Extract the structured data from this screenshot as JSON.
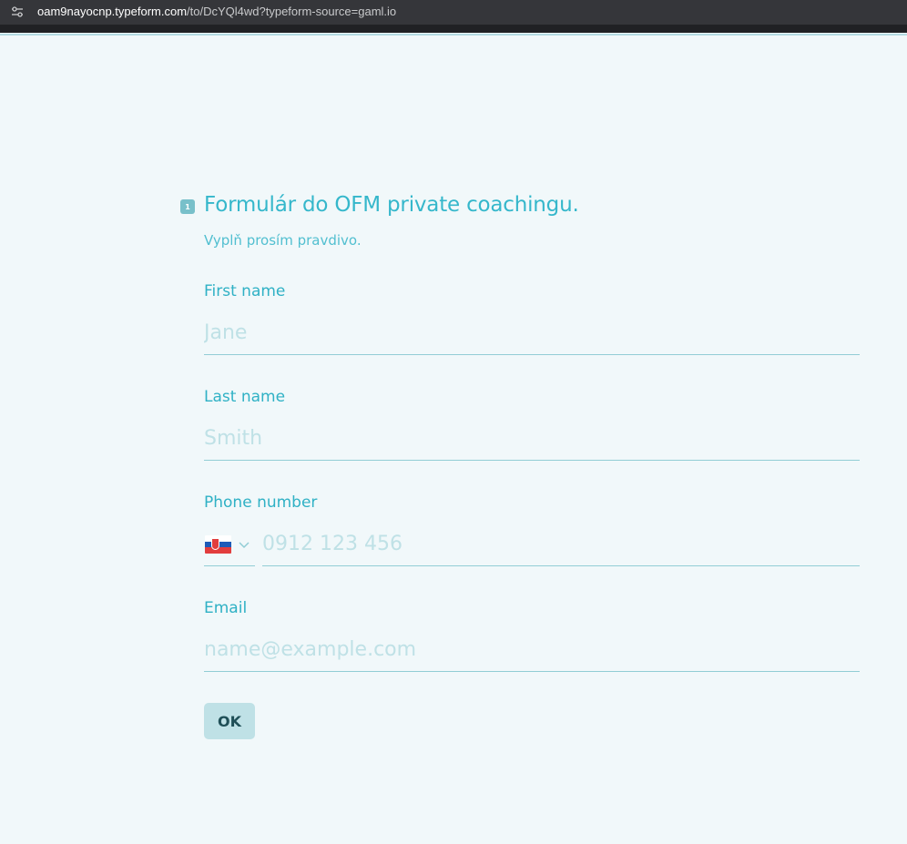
{
  "browser": {
    "url_domain": "oam9nayocnp.typeform.com",
    "url_path": "/to/DcYQl4wd?typeform-source=gaml.io",
    "site_info_icon": "site-settings-icon"
  },
  "form": {
    "question_number": "1",
    "title": "Formulár do OFM private coachingu.",
    "subtitle": "Vyplň prosím pravdivo.",
    "fields": {
      "first_name": {
        "label": "First name",
        "value": "",
        "placeholder": "Jane"
      },
      "last_name": {
        "label": "Last name",
        "value": "",
        "placeholder": "Smith"
      },
      "phone": {
        "label": "Phone number",
        "value": "",
        "placeholder": "0912 123 456",
        "country_icon": "slovakia-flag-icon"
      },
      "email": {
        "label": "Email",
        "value": "",
        "placeholder": "name@example.com"
      }
    },
    "ok_label": "OK"
  },
  "colors": {
    "background": "#f1f8fa",
    "accent": "#35b7cb",
    "placeholder": "#bfe1e6",
    "button_bg": "#bfe1e6",
    "button_text": "#1f4f57"
  }
}
